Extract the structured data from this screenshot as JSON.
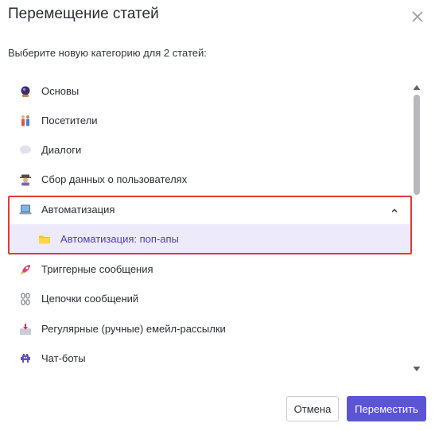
{
  "dialog": {
    "title": "Перемещение статей",
    "subtitle": "Выберите новую категорию для 2 статей:"
  },
  "categories": [
    {
      "label": "Основы",
      "icon": "crystal-ball-icon"
    },
    {
      "label": "Посетители",
      "icon": "people-icon"
    },
    {
      "label": "Диалоги",
      "icon": "speech-bubble-icon"
    },
    {
      "label": "Сбор данных о пользователях",
      "icon": "detective-icon"
    },
    {
      "label": "Автоматизация",
      "icon": "laptop-icon",
      "expanded": true
    },
    {
      "label": "Автоматизация: поп-апы",
      "icon": "folder-icon",
      "selected": true,
      "child": true
    },
    {
      "label": "Триггерные сообщения",
      "icon": "rocket-icon"
    },
    {
      "label": "Цепочки сообщений",
      "icon": "chain-icon"
    },
    {
      "label": "Регулярные (ручные) емейл-рассылки",
      "icon": "inbox-icon"
    },
    {
      "label": "Чат-боты",
      "icon": "space-invader-icon"
    }
  ],
  "buttons": {
    "cancel": "Отмена",
    "move": "Переместить"
  },
  "colors": {
    "accent": "#5b55d6",
    "selected_bg": "#edeafb",
    "selected_text": "#4a42b3",
    "highlight_border": "#e53935"
  }
}
